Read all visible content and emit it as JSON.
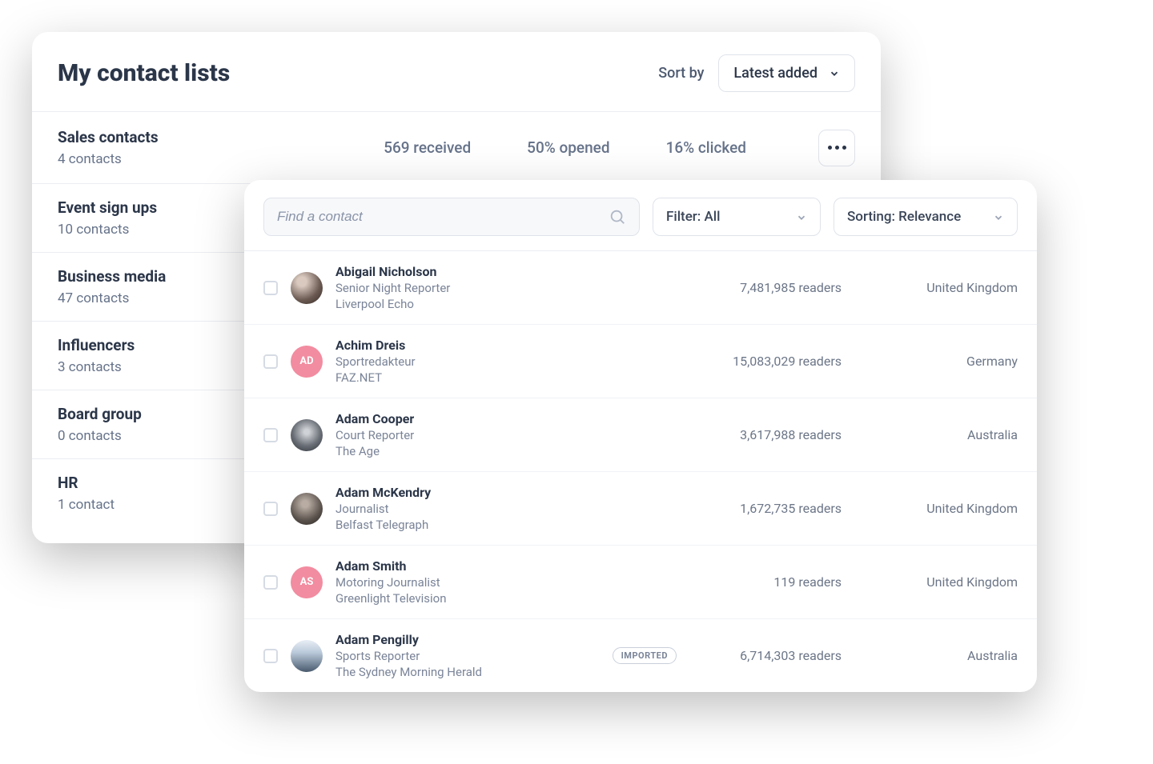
{
  "lists_panel": {
    "title": "My contact lists",
    "sort_by_label": "Sort by",
    "sort_value": "Latest added",
    "selected_list": {
      "name": "Sales contacts",
      "count": "4 contacts",
      "metrics": {
        "received": "569 received",
        "opened": "50% opened",
        "clicked": "16% clicked"
      }
    },
    "items": [
      {
        "name": "Event sign ups",
        "count": "10 contacts"
      },
      {
        "name": "Business media",
        "count": "47 contacts"
      },
      {
        "name": "Influencers",
        "count": "3 contacts"
      },
      {
        "name": "Board group",
        "count": "0 contacts"
      },
      {
        "name": "HR",
        "count": "1 contact"
      }
    ]
  },
  "contacts_panel": {
    "search_placeholder": "Find a contact",
    "filter_label": "Filter: All",
    "sorting_label": "Sorting: Relevance",
    "imported_badge": "IMPORTED",
    "rows": [
      {
        "name": "Abigail Nicholson",
        "role": "Senior Night Reporter",
        "org": "Liverpool Echo",
        "readers": "7,481,985 readers",
        "country": "United Kingdom",
        "initials": "",
        "avatar_class": "av-photo1",
        "imported": false
      },
      {
        "name": "Achim Dreis",
        "role": "Sportredakteur",
        "org": "FAZ.NET",
        "readers": "15,083,029 readers",
        "country": "Germany",
        "initials": "AD",
        "avatar_class": "av-pink",
        "imported": false
      },
      {
        "name": "Adam Cooper",
        "role": "Court Reporter",
        "org": "The Age",
        "readers": "3,617,988 readers",
        "country": "Australia",
        "initials": "",
        "avatar_class": "av-photo2",
        "imported": false
      },
      {
        "name": "Adam McKendry",
        "role": "Journalist",
        "org": "Belfast Telegraph",
        "readers": "1,672,735 readers",
        "country": "United Kingdom",
        "initials": "",
        "avatar_class": "av-photo3",
        "imported": false
      },
      {
        "name": "Adam Smith",
        "role": "Motoring Journalist",
        "org": "Greenlight Television",
        "readers": "119 readers",
        "country": "United Kingdom",
        "initials": "AS",
        "avatar_class": "av-pink",
        "imported": false
      },
      {
        "name": "Adam Pengilly",
        "role": "Sports Reporter",
        "org": "The Sydney Morning Herald",
        "readers": "6,714,303 readers",
        "country": "Australia",
        "initials": "",
        "avatar_class": "av-photo4",
        "imported": true
      }
    ]
  }
}
